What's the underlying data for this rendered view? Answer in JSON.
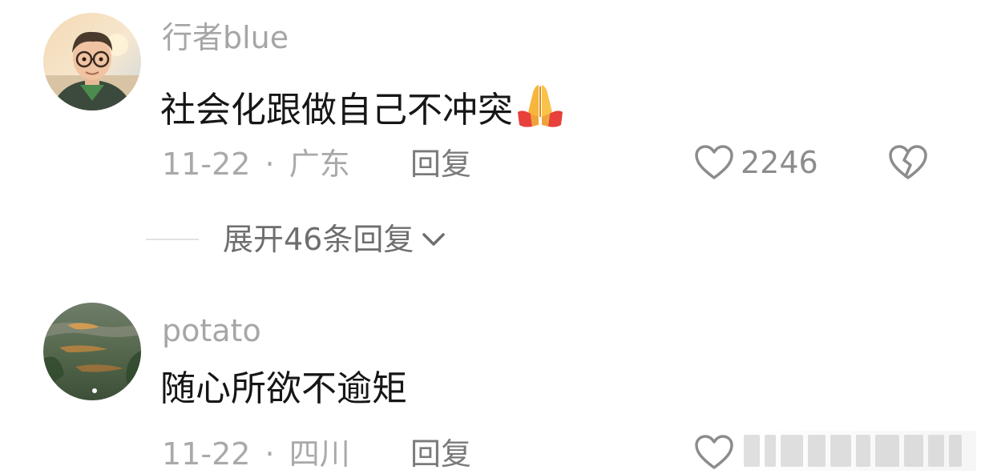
{
  "comments": [
    {
      "username": "行者blue",
      "text": "社会化跟做自己不冲突",
      "emoji": "folded-hands",
      "date": "11-22",
      "separator": "·",
      "location": "广东",
      "reply_label": "回复",
      "like_count": "2246"
    },
    {
      "username": "potato",
      "text": "随心所欲不逾矩",
      "date": "11-22",
      "separator": "·",
      "location": "四川",
      "reply_label": "回复",
      "like_count": ""
    }
  ],
  "expand_replies": {
    "label": "展开46条回复"
  },
  "icons": {
    "like": "heart-outline-icon",
    "dislike": "broken-heart-icon",
    "expand": "chevron-down-icon"
  },
  "colors": {
    "username": "#a6a6a6",
    "text": "#161616",
    "meta": "#a9a9a9",
    "icon": "#8c8c8c"
  }
}
